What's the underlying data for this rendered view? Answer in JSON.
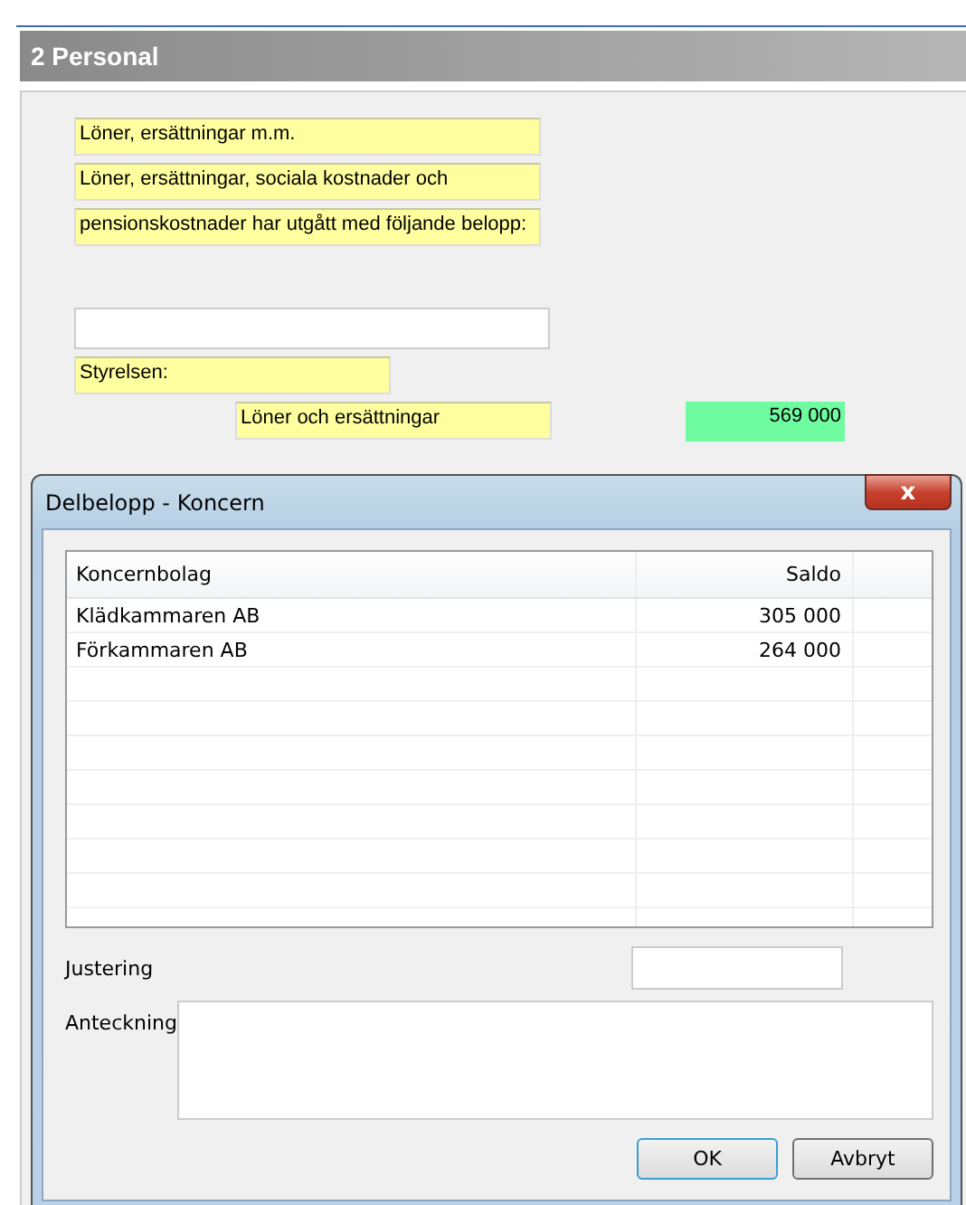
{
  "section": {
    "title": "2 Personal"
  },
  "form_fields": [
    {
      "text": "Löner, ersättningar m.m.",
      "kind": "note"
    },
    {
      "text": "Löner, ersättningar, sociala kostnader och",
      "kind": "note"
    },
    {
      "text": "pensionskostnader har utgått med följande belopp:",
      "kind": "note"
    },
    {
      "kind": "gap"
    },
    {
      "kind": "input"
    },
    {
      "text": "Styrelsen:",
      "kind": "short"
    }
  ],
  "salary_row": {
    "label": "Löner och ersättningar",
    "amount": "569 000"
  },
  "dialog": {
    "title": "Delbelopp - Koncern",
    "close_icon": "x",
    "table": {
      "columns": [
        "Koncernbolag",
        "Saldo"
      ],
      "rows": [
        {
          "company": "Klädkammaren AB",
          "balance": "305 000"
        },
        {
          "company": "Förkammaren AB",
          "balance": "264 000"
        }
      ]
    },
    "adjustment_label": "Justering",
    "note_label": "Anteckning",
    "buttons": [
      {
        "label": "OK",
        "default": true
      },
      {
        "label": "Avbryt",
        "default": false
      }
    ]
  }
}
